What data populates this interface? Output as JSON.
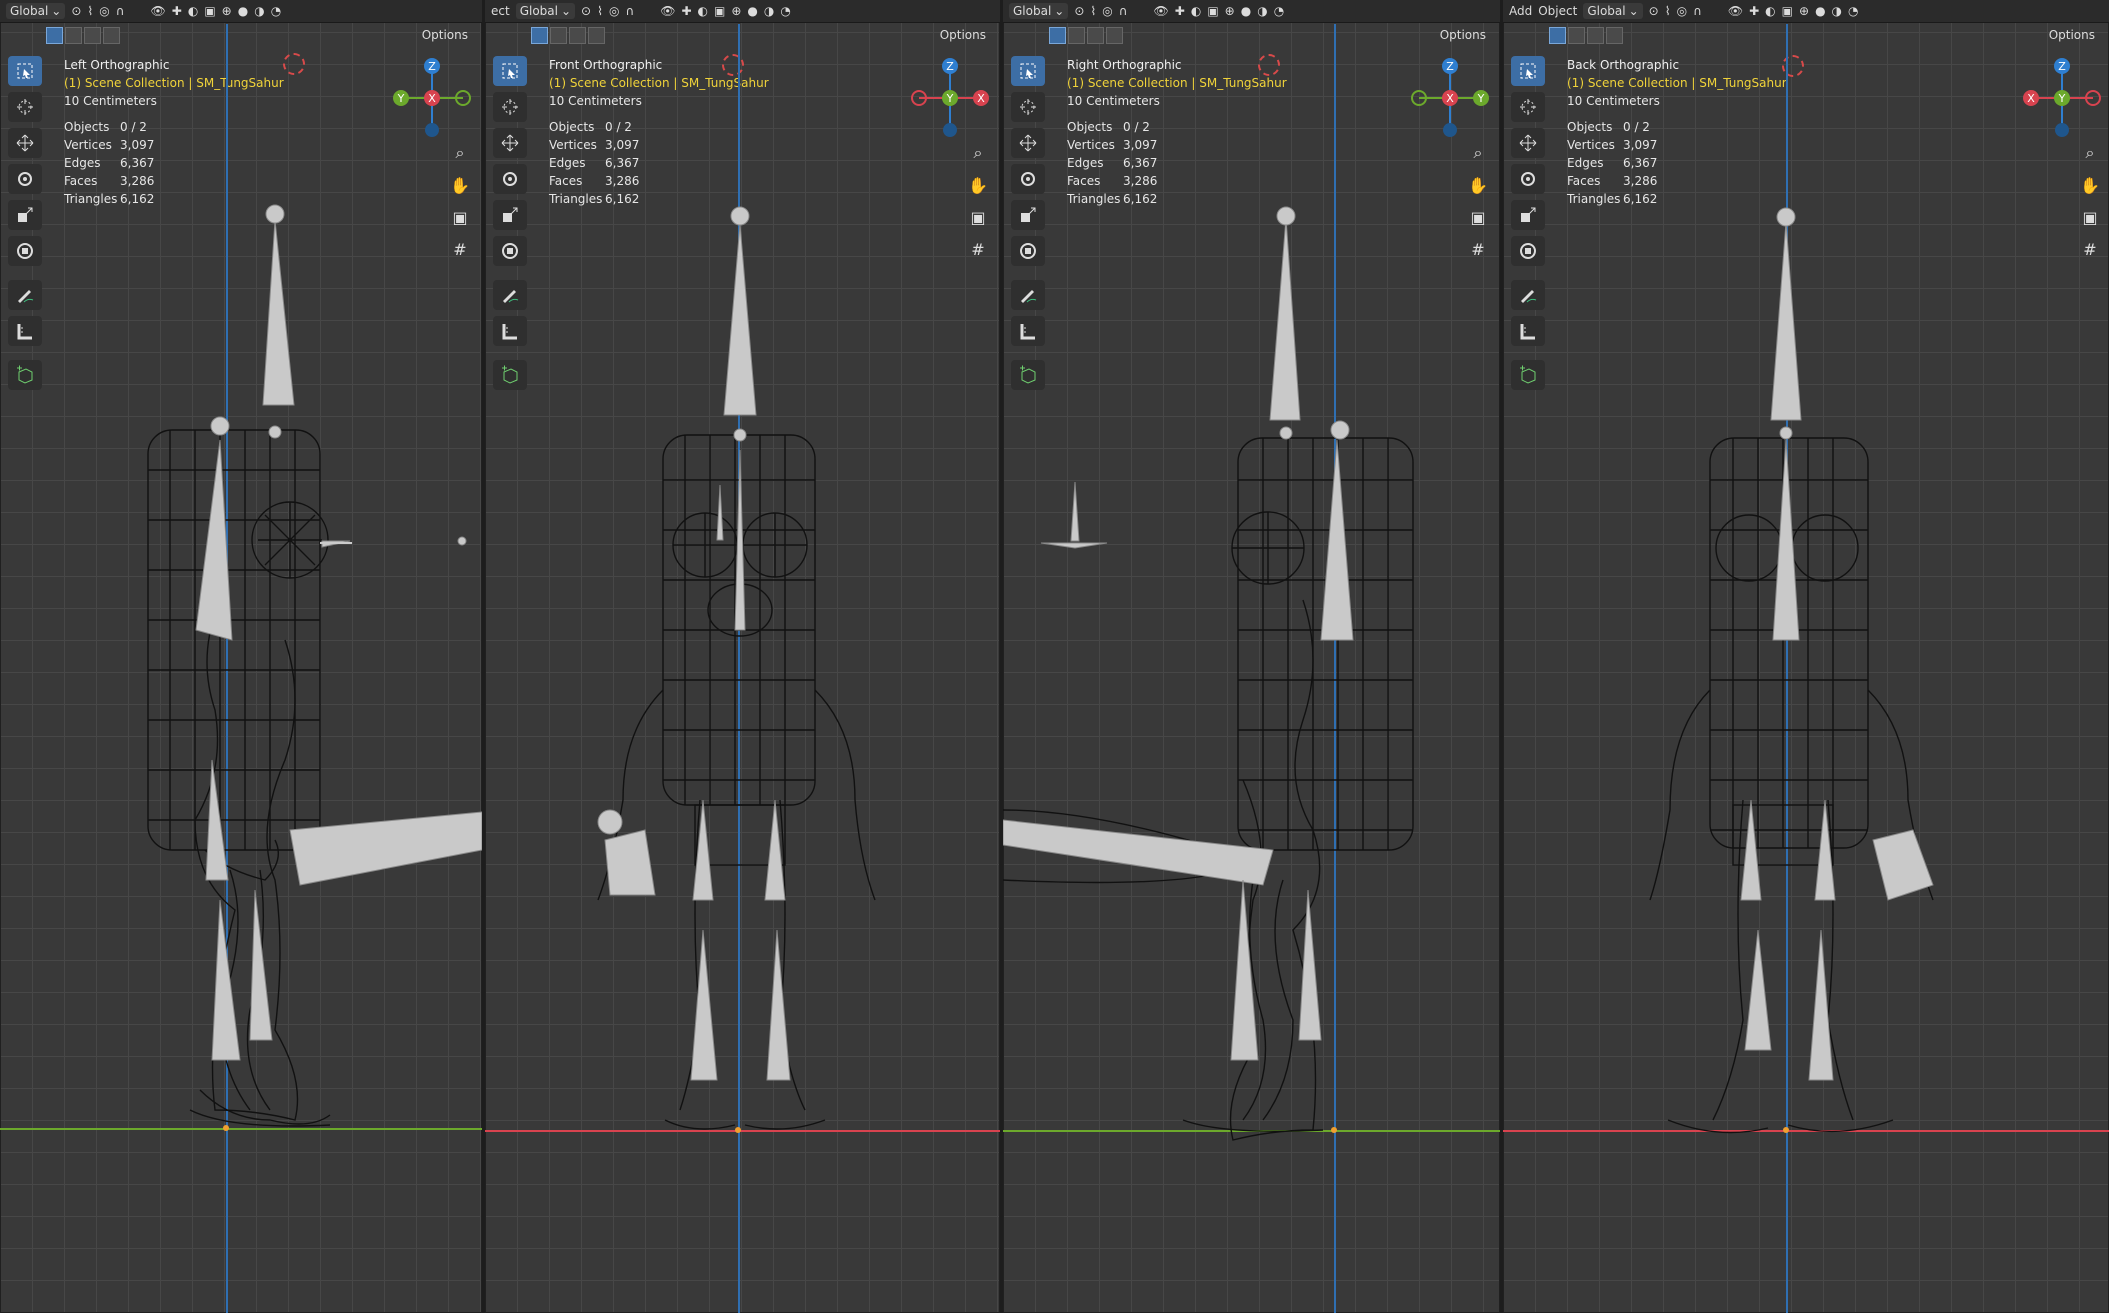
{
  "header_labels": {
    "global": "Global",
    "add": "Add",
    "object": "Object",
    "cut_object": "ect",
    "options": "Options"
  },
  "viewports": [
    {
      "view_name": "Left Orthographic",
      "collection": "(1) Scene Collection | SM_TungSahur",
      "scale": "10 Centimeters",
      "gizmo": {
        "top": "Z",
        "left": "Y",
        "center": "X"
      }
    },
    {
      "view_name": "Front Orthographic",
      "collection": "(1) Scene Collection | SM_TungSahur",
      "scale": "10 Centimeters",
      "gizmo": {
        "top": "Z",
        "left": "",
        "center": "Y",
        "right": "X"
      }
    },
    {
      "view_name": "Right Orthographic",
      "collection": "(1) Scene Collection | SM_TungSahur",
      "scale": "10 Centimeters",
      "gizmo": {
        "top": "Z",
        "left": "",
        "center": "X",
        "right": "Y"
      }
    },
    {
      "view_name": "Back Orthographic",
      "collection": "(1) Scene Collection | SM_TungSahur",
      "scale": "10 Centimeters",
      "gizmo": {
        "top": "Z",
        "left": "X",
        "center": "Y",
        "right": ""
      }
    }
  ],
  "stats": {
    "objects_label": "Objects",
    "objects": "0 / 2",
    "vertices_label": "Vertices",
    "vertices": "3,097",
    "edges_label": "Edges",
    "edges": "6,367",
    "faces_label": "Faces",
    "faces": "3,286",
    "triangles_label": "Triangles",
    "triangles": "6,162"
  },
  "colors": {
    "x_axis": "#d8434f",
    "y_axis": "#6ca92c",
    "z_axis": "#2f7fd1",
    "viewport_bg": "#393939",
    "grid": "#474747",
    "collection_text": "#f0d33a",
    "active_tool": "#3d6ea5"
  },
  "tool_icons": [
    "select-box-icon",
    "cursor-icon",
    "move-icon",
    "rotate-icon",
    "scale-icon",
    "transform-icon",
    "annotate-icon",
    "measure-icon",
    "add-cube-icon"
  ],
  "nav_icons": [
    "zoom-icon",
    "pan-hand-icon",
    "camera-icon",
    "grid-icon"
  ]
}
